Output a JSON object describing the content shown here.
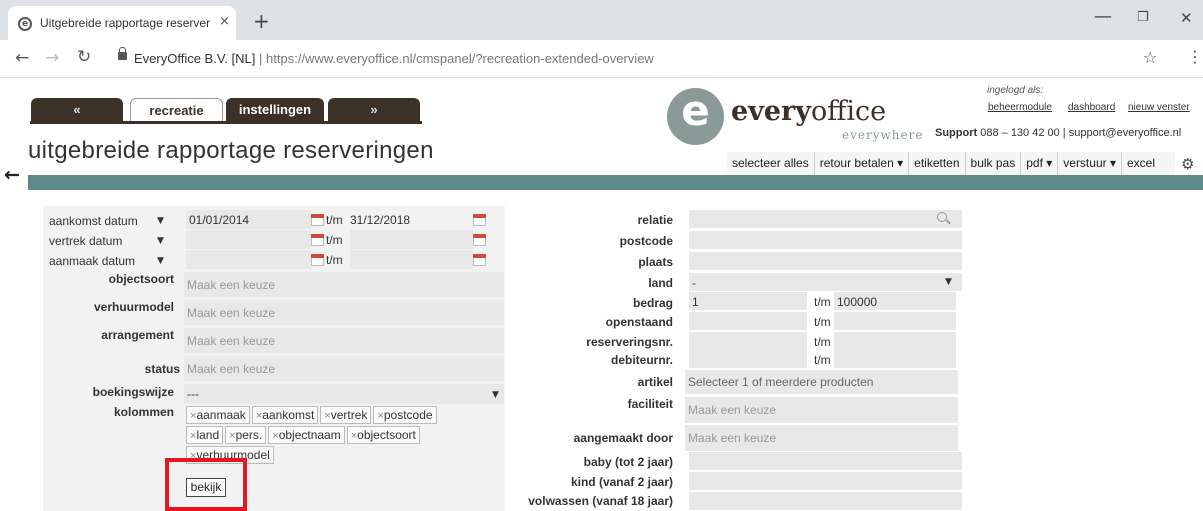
{
  "browser": {
    "tab_title": "Uitgebreide rapportage reserveri",
    "tab_close": "×",
    "new_tab": "+",
    "url_site": "EveryOffice B.V. [NL]",
    "url_sep": "|",
    "url_prefix": "https://www.everyoffice.nl",
    "url_path": "/cmspanel/?recreation-extended-overview"
  },
  "header": {
    "tabs": [
      "«",
      "recreatie",
      "instellingen",
      "»"
    ],
    "logo_word_bold": "every",
    "logo_word": "office",
    "logo_sub": "everywhere",
    "logged_in_label": "ingelogd als:",
    "links": [
      "beheermodule",
      "dashboard",
      "nieuw venster"
    ],
    "support_label": "Support",
    "support_text": "088 – 130 42 00 | support@everyoffice.nl",
    "page_title": "uitgebreide rapportage reserveringen"
  },
  "actions": [
    "selecteer alles",
    "retour betalen ▾",
    "etiketten",
    "bulk pas",
    "pdf ▾",
    "verstuur ▾",
    "excel"
  ],
  "form_left": {
    "date_rows": [
      {
        "type": "aankomst datum",
        "from": "01/01/2014",
        "to_label": "t/m",
        "to": "31/12/2018"
      },
      {
        "type": "vertrek datum",
        "from": "",
        "to_label": "t/m",
        "to": ""
      },
      {
        "type": "aanmaak datum",
        "from": "",
        "to_label": "t/m",
        "to": ""
      }
    ],
    "objectsoort": {
      "label": "objectsoort",
      "placeholder": "Maak een keuze"
    },
    "verhuurmodel": {
      "label": "verhuurmodel",
      "placeholder": "Maak een keuze"
    },
    "arrangement": {
      "label": "arrangement",
      "placeholder": "Maak een keuze"
    },
    "status": {
      "label": "status",
      "placeholder": "Maak een keuze"
    },
    "boekingswijze": {
      "label": "boekingswijze",
      "value": "---"
    },
    "kolommen": {
      "label": "kolommen",
      "tags": [
        "aanmaak",
        "aankomst",
        "vertrek",
        "postcode",
        "land",
        "pers.",
        "objectnaam",
        "objectsoort",
        "verhuurmodel"
      ]
    },
    "bekijk": "bekijk"
  },
  "form_right": {
    "relatie": "relatie",
    "postcode": "postcode",
    "plaats": "plaats",
    "land": {
      "label": "land",
      "value": "-"
    },
    "bedrag": {
      "label": "bedrag",
      "from": "1",
      "to_label": "t/m",
      "to": "100000"
    },
    "openstaand": {
      "label": "openstaand",
      "to_label": "t/m"
    },
    "reserveringsnr": {
      "label": "reserveringsnr.",
      "to_label": "t/m"
    },
    "debiteurnr": {
      "label": "debiteurnr.",
      "to_label": "t/m"
    },
    "artikel": {
      "label": "artikel",
      "placeholder": "Selecteer 1 of meerdere producten"
    },
    "faciliteit": {
      "label": "faciliteit",
      "placeholder": "Maak een keuze"
    },
    "aangemaakt": {
      "label": "aangemaakt door",
      "placeholder": "Maak een keuze"
    },
    "baby": "baby (tot 2 jaar)",
    "kind": "kind (vanaf 2 jaar)",
    "volwassen": "volwassen (vanaf 18 jaar)"
  },
  "colors": {
    "brand_dark": "#3b3127",
    "teal": "#5e8a8c",
    "highlight": "#e8141e"
  }
}
